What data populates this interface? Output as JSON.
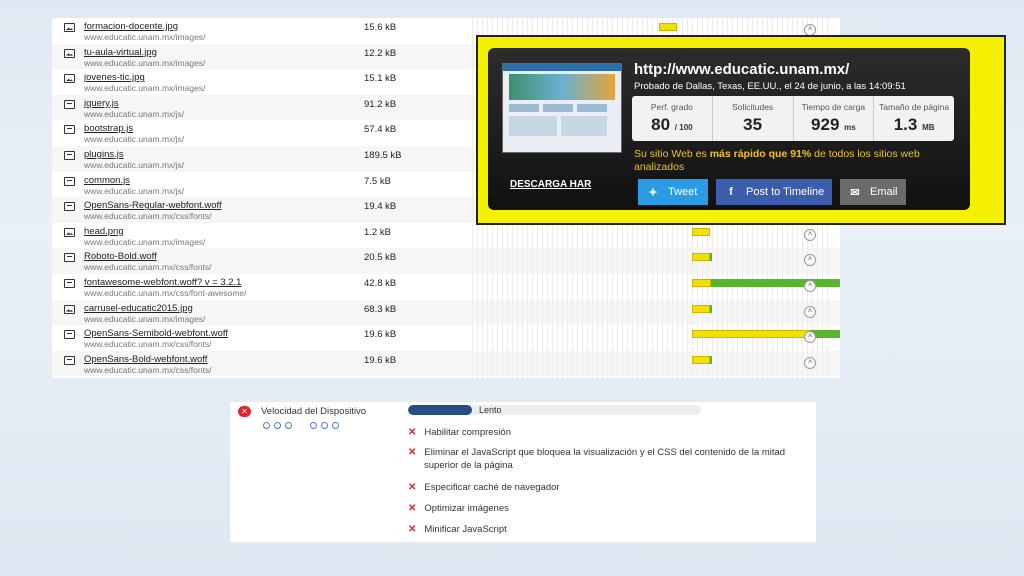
{
  "waterfall": {
    "toggle_icon": "chevron-up",
    "rows": [
      {
        "name": "formacion-docente.jpg",
        "path": "www.educatic.unam.mx/images/",
        "size": "15.6 kB",
        "type": "image",
        "bar": {
          "start": 0.52,
          "yellow": 0.05,
          "green": 0
        }
      },
      {
        "name": "tu-aula-virtual.jpg",
        "path": "www.educatic.unam.mx/images/",
        "size": "12.2 kB",
        "type": "image",
        "bar": null
      },
      {
        "name": "jovenes-tic.jpg",
        "path": "www.educatic.unam.mx/images/",
        "size": "15.1 kB",
        "type": "image",
        "bar": null
      },
      {
        "name": "jquery.js",
        "path": "www.educatic.unam.mx/js/",
        "size": "91.2 kB",
        "type": "doc",
        "bar": null
      },
      {
        "name": "bootstrap.js",
        "path": "www.educatic.unam.mx/js/",
        "size": "57.4 kB",
        "type": "doc",
        "bar": null
      },
      {
        "name": "plugins.js",
        "path": "www.educatic.unam.mx/js/",
        "size": "189.5 kB",
        "type": "doc",
        "bar": null
      },
      {
        "name": "common.js",
        "path": "www.educatic.unam.mx/js/",
        "size": "7.5 kB",
        "type": "doc",
        "bar": null
      },
      {
        "name": "OpenSans-Regular-webfont.woff",
        "path": "www.educatic.unam.mx/css/fonts/",
        "size": "19.4 kB",
        "type": "doc",
        "bar": null
      },
      {
        "name": "head.png",
        "path": "www.educatic.unam.mx/images/",
        "size": "1.2 kB",
        "type": "image",
        "bar": {
          "start": 0.61,
          "yellow": 0.05,
          "green": 0
        }
      },
      {
        "name": "Roboto-Bold.woff",
        "path": "www.educatic.unam.mx/css/fonts/",
        "size": "20.5 kB",
        "type": "doc",
        "bar": {
          "start": 0.61,
          "yellow": 0.05,
          "green": 0.005
        }
      },
      {
        "name": "fontawesome-webfont.woff? v = 3.2.1",
        "path": "www.educatic.unam.mx/css/font-awesome/",
        "size": "42.8 kB",
        "type": "doc",
        "bar": {
          "start": 0.61,
          "yellow": 0.055,
          "green": 0.47
        }
      },
      {
        "name": "carrusel-educatic2015.jpg",
        "path": "www.educatic.unam.mx/images/",
        "size": "68.3 kB",
        "type": "image",
        "bar": {
          "start": 0.61,
          "yellow": 0.05,
          "green": 0.005
        }
      },
      {
        "name": "OpenSans-Semibold-webfont.woff",
        "path": "www.educatic.unam.mx/css/fonts/",
        "size": "19.6 kB",
        "type": "doc",
        "bar": {
          "start": 0.61,
          "yellow": 0.33,
          "green": 0.21
        }
      },
      {
        "name": "OpenSans-Bold-webfont.woff",
        "path": "www.educatic.unam.mx/css/fonts/",
        "size": "19.6 kB",
        "type": "doc",
        "bar": {
          "start": 0.61,
          "yellow": 0.05,
          "green": 0.005
        }
      }
    ]
  },
  "result": {
    "download_label": "DESCARGA HAR",
    "url": "http://www.educatic.unam.mx/",
    "tested_from": "Probado de Dallas, Texas, EE.UU., el 24 de junio, a las 14:09:51",
    "metrics": [
      {
        "label": "Perf. grado",
        "value": "80",
        "unit": "/ 100"
      },
      {
        "label": "Solicitudes",
        "value": "35",
        "unit": ""
      },
      {
        "label": "Tiempo de carga",
        "value": "929",
        "unit": "ms"
      },
      {
        "label": "Tamaño de página",
        "value": "1.3",
        "unit": "MB"
      }
    ],
    "speed_prefix": "Su sitio Web es ",
    "speed_bold": "más rápido que 91%",
    "speed_suffix": " de todos los sitios web analizados",
    "tweet_label": "Tweet",
    "facebook_label": "Post to Timeline",
    "email_label": "Email",
    "colors": {
      "highlight": "#f5f000",
      "tweet": "#2b9be5",
      "facebook": "#3b5dab",
      "email": "#6b6b6b"
    }
  },
  "pagespeed": {
    "category": "Velocidad del Dispositivo",
    "rating": "Lento",
    "rating_fill": 0.22,
    "rules": [
      "Habilitar compresión",
      "Eliminar el JavaScript que bloquea la visualización y el CSS del contenido de la mitad superior de la página",
      "Especificar caché de navegador",
      "Optimizar imágenes",
      "Minificar JavaScript"
    ]
  }
}
